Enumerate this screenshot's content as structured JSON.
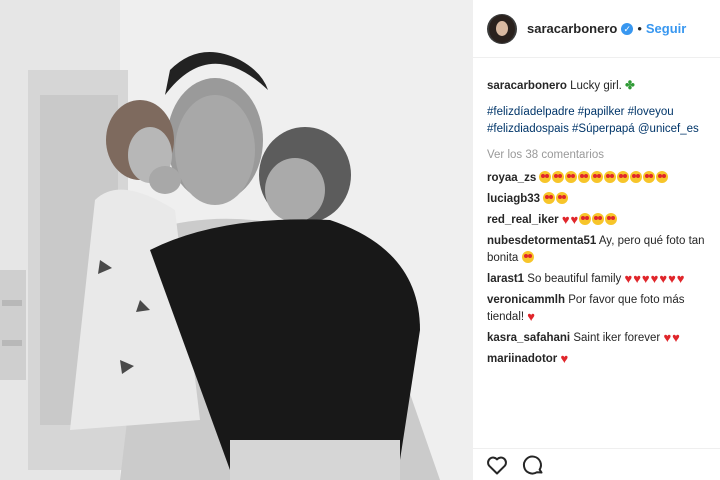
{
  "post": {
    "username": "saracarbonero",
    "verified_icon": "verified-badge-icon",
    "separator": "•",
    "follow_label": "Seguir",
    "caption_user": "saracarbonero",
    "caption_text": "Lucky girl. ",
    "caption_emoji": "four-leaf-clover",
    "hashtags_line1": "#felizdíadelpadre #papilker #loveyou",
    "hashtags_line2": "#felizdiadospais #Súperpapá @unicef_es",
    "view_comments": "Ver los 38 comentarios"
  },
  "comments": [
    {
      "user": "royaa_zs",
      "text": "",
      "emojis": [
        "heart-eyes",
        "heart-eyes",
        "heart-eyes",
        "heart-eyes",
        "heart-eyes",
        "heart-eyes",
        "heart-eyes",
        "heart-eyes",
        "heart-eyes",
        "heart-eyes"
      ]
    },
    {
      "user": "luciagb33",
      "text": "",
      "emojis": [
        "heart-eyes",
        "heart-eyes"
      ]
    },
    {
      "user": "red_real_iker",
      "text": "",
      "emojis": [
        "heart",
        "heart",
        "heart-eyes",
        "heart-eyes",
        "heart-eyes"
      ]
    },
    {
      "user": "nubesdetormenta51",
      "text": "Ay, pero qué foto tan bonita",
      "emojis": [
        "heart-eyes"
      ]
    },
    {
      "user": "larast1",
      "text": "So beautiful family",
      "emojis": [
        "heart",
        "heart",
        "heart",
        "heart",
        "heart",
        "heart",
        "heart"
      ]
    },
    {
      "user": "veronicammlh",
      "text": "Por favor que foto más tiendal!",
      "emojis": [
        "heart"
      ]
    },
    {
      "user": "kasra_safahani",
      "text": "Saint iker forever",
      "emojis": [
        "heart",
        "heart"
      ]
    },
    {
      "user": "mariinadotor",
      "text": "",
      "emojis": [
        "heart"
      ]
    }
  ],
  "actions": {
    "like_icon": "heart-outline-icon",
    "comment_icon": "comment-bubble-icon"
  },
  "colors": {
    "link": "#3897f0",
    "hashtag": "#003569",
    "muted": "#999999",
    "heart": "#e0262b"
  }
}
